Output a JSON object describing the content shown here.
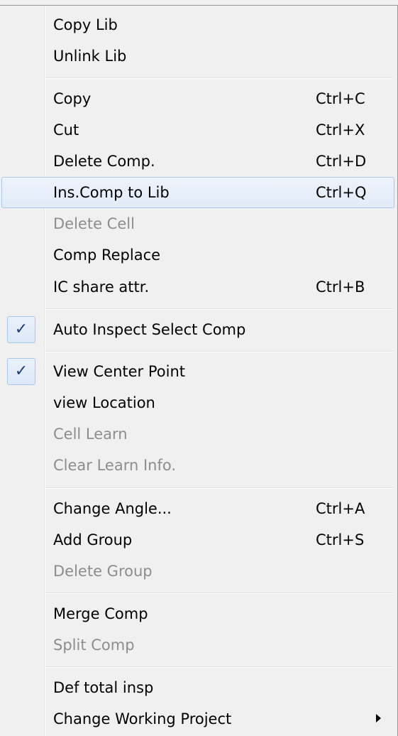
{
  "menu": {
    "copy_lib": {
      "label": "Copy Lib"
    },
    "unlink_lib": {
      "label": "Unlink Lib"
    },
    "copy": {
      "label": "Copy",
      "shortcut": "Ctrl+C"
    },
    "cut": {
      "label": "Cut",
      "shortcut": "Ctrl+X"
    },
    "delete_comp": {
      "label": "Delete Comp.",
      "shortcut": "Ctrl+D"
    },
    "ins_comp_to_lib": {
      "label": "Ins.Comp to Lib",
      "shortcut": "Ctrl+Q",
      "highlighted": true
    },
    "delete_cell": {
      "label": "Delete Cell",
      "disabled": true
    },
    "comp_replace": {
      "label": "Comp Replace"
    },
    "ic_share_attr": {
      "label": "IC share attr.",
      "shortcut": "Ctrl+B"
    },
    "auto_inspect_select_comp": {
      "label": "Auto Inspect Select Comp",
      "checked": true
    },
    "view_center_point": {
      "label": "View Center Point",
      "checked": true
    },
    "view_location": {
      "label": "view Location"
    },
    "cell_learn": {
      "label": "Cell Learn",
      "disabled": true
    },
    "clear_learn_info": {
      "label": "Clear Learn Info.",
      "disabled": true
    },
    "change_angle": {
      "label": "Change Angle...",
      "shortcut": "Ctrl+A"
    },
    "add_group": {
      "label": "Add Group",
      "shortcut": "Ctrl+S"
    },
    "delete_group": {
      "label": "Delete Group",
      "disabled": true
    },
    "merge_comp": {
      "label": "Merge Comp"
    },
    "split_comp": {
      "label": "Split Comp",
      "disabled": true
    },
    "def_total_insp": {
      "label": "Def total insp"
    },
    "change_working_project": {
      "label": "Change Working Project",
      "has_submenu": true
    }
  },
  "icons": {
    "check": "✓",
    "submenu_arrow": "submenu-arrow-icon"
  },
  "colors": {
    "menu_background": "#f0f0f0",
    "highlight_background": "#e8effa",
    "highlight_border": "#a9c7ee",
    "disabled_text": "#8d8d8d",
    "check_color": "#1b3f78"
  }
}
